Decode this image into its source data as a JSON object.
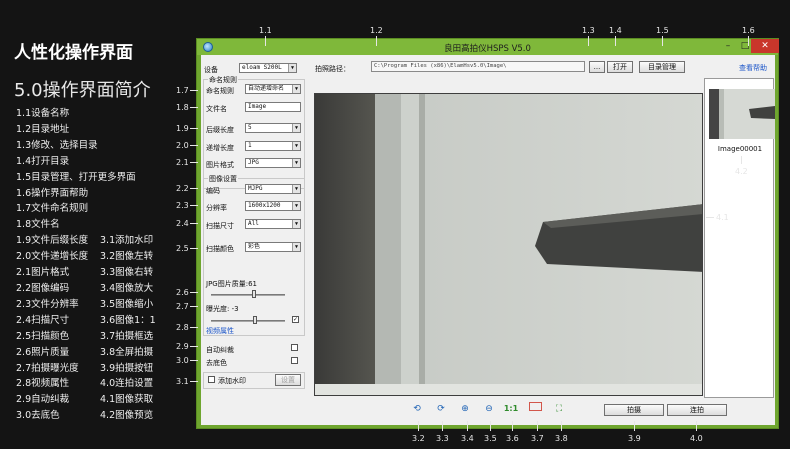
{
  "slide": {
    "title": "人性化操作界面",
    "subtitle": "5.0操作界面简介",
    "legend": [
      [
        "1.1设备名称",
        ""
      ],
      [
        "1.2目录地址",
        ""
      ],
      [
        "1.3修改、选择目录",
        ""
      ],
      [
        "1.4打开目录",
        ""
      ],
      [
        "1.5目录管理、打开更多界面",
        ""
      ],
      [
        "1.6操作界面帮助",
        ""
      ],
      [
        "1.7文件命名规则",
        ""
      ],
      [
        "1.8文件名",
        ""
      ],
      [
        "1.9文件后缀长度",
        "3.1添加水印"
      ],
      [
        "2.0文件递增长度",
        "3.2图像左转"
      ],
      [
        "2.1图片格式",
        "3.3图像右转"
      ],
      [
        "2.2图像编码",
        "3.4图像放大"
      ],
      [
        "2.3文件分辨率",
        "3.5图像缩小"
      ],
      [
        "2.4扫描尺寸",
        "3.6图像1：1"
      ],
      [
        "2.5扫描颜色",
        "3.7拍摄框选"
      ],
      [
        "2.6照片质量",
        "3.8全屏拍摄"
      ],
      [
        "2.7拍摄曝光度",
        "3.9拍摄按钮"
      ],
      [
        "2.8视频属性",
        "4.0连拍设置"
      ],
      [
        "2.9自动纠裁",
        "4.1图像获取"
      ],
      [
        "3.0去底色",
        "4.2图像预览"
      ]
    ],
    "annotations": {
      "top": [
        "1.1",
        "1.2",
        "1.3",
        "1.4",
        "1.5",
        "1.6"
      ],
      "left": [
        "1.7",
        "1.8",
        "1.9",
        "2.0",
        "2.1",
        "2.2",
        "2.3",
        "2.4",
        "2.5",
        "2.6",
        "2.7",
        "2.8",
        "2.9",
        "3.0",
        "3.1"
      ],
      "bottom": [
        "3.2",
        "3.3",
        "3.4",
        "3.5",
        "3.6",
        "3.7",
        "3.8",
        "3.9",
        "4.0"
      ],
      "right": [
        "4.2",
        "4.1"
      ]
    }
  },
  "window": {
    "title": "良田高拍仪HSPS V5.0",
    "controls": {
      "minimize": "–",
      "maximize": "□",
      "close": "✕"
    }
  },
  "left_panel": {
    "device_label": "设备",
    "device_value": "eloam S200L",
    "naming_group": "命名规则",
    "naming_rule_label": "命名规则",
    "naming_rule_value": "自动递增命名",
    "filename_label": "文件名",
    "filename_value": "Image",
    "suffix_len_label": "后缀长度",
    "suffix_len_value": "5",
    "increment_label": "递增长度",
    "increment_value": "1",
    "format_label": "图片格式",
    "format_value": "JPG",
    "image_group": "图像设置",
    "encoding_label": "编码",
    "encoding_value": "MJPG",
    "resolution_label": "分辨率",
    "resolution_value": "1600x1200",
    "scan_size_label": "扫描尺寸",
    "scan_size_value": "All",
    "scan_color_label": "扫描颜色",
    "scan_color_value": "彩色",
    "quality_label": "JPG图片质量:61",
    "quality_level": 0.61,
    "exposure_label": "曝光度: -3",
    "video_props": "视频属性",
    "auto_crop": "自动纠裁",
    "remove_bg": "去底色",
    "watermark": "添加水印",
    "watermark_settings": "设置"
  },
  "path_bar": {
    "label": "拍照路径：",
    "value": "C:\\Program Files (x86)\\ElamHsv5.0\\Image\\",
    "browse": "...",
    "open": "打开",
    "manage": "目录管理",
    "help": "查看帮助"
  },
  "thumbnail": {
    "name": "Image00001"
  },
  "toolbar": {
    "capture": "拍摄",
    "continuous": "连拍",
    "one_to_one": "1:1"
  },
  "colors": {
    "window_green": "#7fb83a",
    "link_blue": "#1b55c9",
    "background": "#141414"
  }
}
